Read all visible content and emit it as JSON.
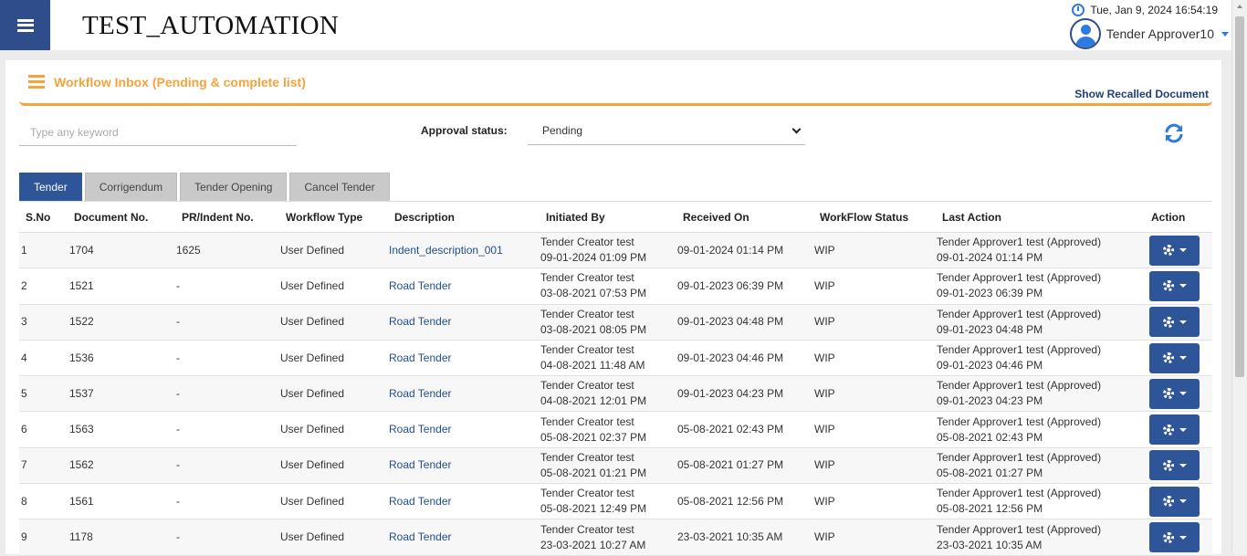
{
  "app": {
    "title": "TEST_AUTOMATION",
    "datetime": "Tue, Jan 9, 2024 16:54:19",
    "user": "Tender Approver10"
  },
  "panel": {
    "title": "Workflow Inbox (Pending & complete list)",
    "recalled_link": "Show Recalled Document"
  },
  "filters": {
    "search_placeholder": "Type any keyword",
    "status_label": "Approval status:",
    "status_value": "Pending"
  },
  "tabs": [
    "Tender",
    "Corrigendum",
    "Tender Opening",
    "Cancel Tender"
  ],
  "columns": [
    "S.No",
    "Document No.",
    "PR/Indent No.",
    "Workflow Type",
    "Description",
    "Initiated By",
    "Received On",
    "WorkFlow Status",
    "Last Action",
    "Action"
  ],
  "rows": [
    {
      "sno": "1",
      "doc": "1704",
      "pr": "1625",
      "type": "User Defined",
      "desc": "Indent_description_001",
      "init_name": "Tender Creator test",
      "init_date": "09-01-2024 01:09 PM",
      "received": "09-01-2024 01:14 PM",
      "status": "WIP",
      "last_name": "Tender Approver1 test (Approved)",
      "last_date": "09-01-2024 01:14 PM"
    },
    {
      "sno": "2",
      "doc": "1521",
      "pr": "-",
      "type": "User Defined",
      "desc": "Road Tender",
      "init_name": "Tender Creator test",
      "init_date": "03-08-2021 07:53 PM",
      "received": "09-01-2023 06:39 PM",
      "status": "WIP",
      "last_name": "Tender Approver1 test (Approved)",
      "last_date": "09-01-2023 06:39 PM"
    },
    {
      "sno": "3",
      "doc": "1522",
      "pr": "-",
      "type": "User Defined",
      "desc": "Road Tender",
      "init_name": "Tender Creator test",
      "init_date": "03-08-2021 08:05 PM",
      "received": "09-01-2023 04:48 PM",
      "status": "WIP",
      "last_name": "Tender Approver1 test (Approved)",
      "last_date": "09-01-2023 04:48 PM"
    },
    {
      "sno": "4",
      "doc": "1536",
      "pr": "-",
      "type": "User Defined",
      "desc": "Road Tender",
      "init_name": "Tender Creator test",
      "init_date": "04-08-2021 11:48 AM",
      "received": "09-01-2023 04:46 PM",
      "status": "WIP",
      "last_name": "Tender Approver1 test (Approved)",
      "last_date": "09-01-2023 04:46 PM"
    },
    {
      "sno": "5",
      "doc": "1537",
      "pr": "-",
      "type": "User Defined",
      "desc": "Road Tender",
      "init_name": "Tender Creator test",
      "init_date": "04-08-2021 12:01 PM",
      "received": "09-01-2023 04:23 PM",
      "status": "WIP",
      "last_name": "Tender Approver1 test (Approved)",
      "last_date": "09-01-2023 04:23 PM"
    },
    {
      "sno": "6",
      "doc": "1563",
      "pr": "-",
      "type": "User Defined",
      "desc": "Road Tender",
      "init_name": "Tender Creator test",
      "init_date": "05-08-2021 02:37 PM",
      "received": "05-08-2021 02:43 PM",
      "status": "WIP",
      "last_name": "Tender Approver1 test (Approved)",
      "last_date": "05-08-2021 02:43 PM"
    },
    {
      "sno": "7",
      "doc": "1562",
      "pr": "-",
      "type": "User Defined",
      "desc": "Road Tender",
      "init_name": "Tender Creator test",
      "init_date": "05-08-2021 01:21 PM",
      "received": "05-08-2021 01:27 PM",
      "status": "WIP",
      "last_name": "Tender Approver1 test (Approved)",
      "last_date": "05-08-2021 01:27 PM"
    },
    {
      "sno": "8",
      "doc": "1561",
      "pr": "-",
      "type": "User Defined",
      "desc": "Road Tender",
      "init_name": "Tender Creator test",
      "init_date": "05-08-2021 12:49 PM",
      "received": "05-08-2021 12:56 PM",
      "status": "WIP",
      "last_name": "Tender Approver1 test (Approved)",
      "last_date": "05-08-2021 12:56 PM"
    },
    {
      "sno": "9",
      "doc": "1178",
      "pr": "-",
      "type": "User Defined",
      "desc": "Road Tender",
      "init_name": "Tender Creator test",
      "init_date": "23-03-2021 10:27 AM",
      "received": "23-03-2021 10:35 AM",
      "status": "WIP",
      "last_name": "Tender Approver1 test (Approved)",
      "last_date": "23-03-2021 10:35 AM"
    }
  ]
}
